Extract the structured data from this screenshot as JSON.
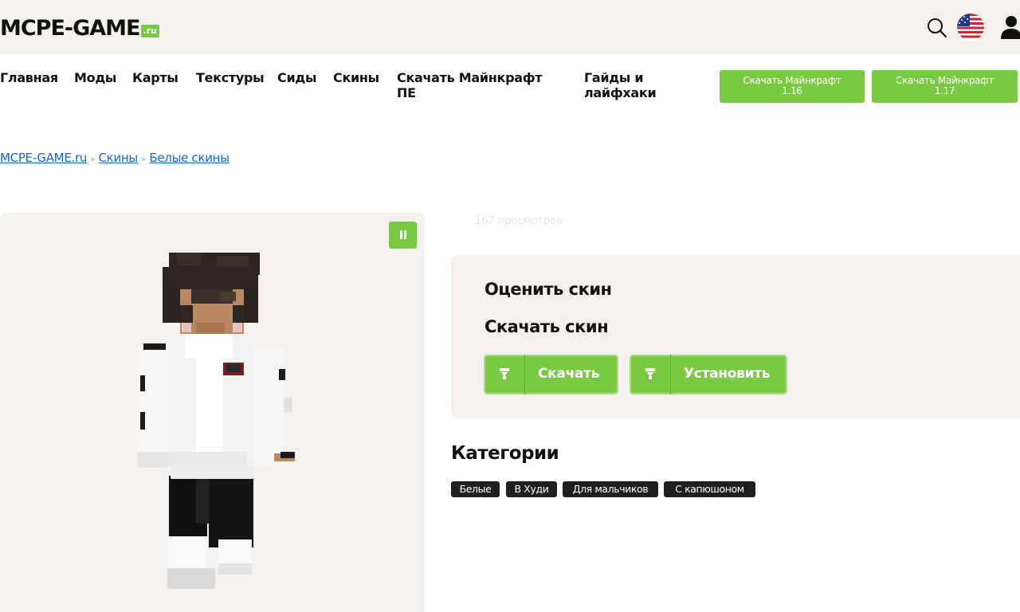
{
  "header": {
    "logo_main": "MCPE-GAME",
    "logo_suffix": ".ru",
    "icons": [
      "search-icon",
      "us-flag-icon",
      "user-icon"
    ]
  },
  "nav": {
    "items": [
      {
        "label": "Главная"
      },
      {
        "label": "Моды"
      },
      {
        "label": "Карты"
      },
      {
        "label": "Текстуры"
      },
      {
        "label": "Сиды"
      },
      {
        "label": "Скины"
      },
      {
        "label": "Скачать Майнкрафт ПЕ"
      },
      {
        "label": "Гайды и лайфхаки"
      }
    ],
    "download_buttons": [
      {
        "line1": "Скачать Майнкрафт",
        "line2": "1.16"
      },
      {
        "line1": "Скачать Майнкрафт",
        "line2": "1.17"
      }
    ]
  },
  "breadcrumb": {
    "items": [
      "MCPE-GAME.ru",
      "Скины",
      "Белые скины"
    ],
    "separator": "»"
  },
  "skin": {
    "views": "167 просмотров",
    "rate_title": "Оценить скин",
    "download_title": "Скачать скин",
    "download_button": "Скачать",
    "install_button": "Установить"
  },
  "categories": {
    "title": "Категории",
    "tags": [
      "Белые",
      "В Худи",
      "Для мальчиков",
      "С капюшоном"
    ]
  },
  "colors": {
    "accent": "#7ac943",
    "panel": "#f4f1ec",
    "link": "#1a63d6",
    "tag_bg": "#1f1f1f"
  }
}
